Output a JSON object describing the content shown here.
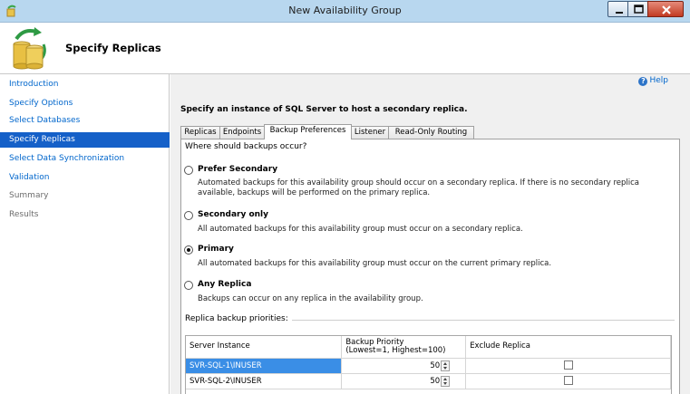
{
  "window": {
    "title": "New Availability Group"
  },
  "header": {
    "page_title": "Specify Replicas"
  },
  "sidebar": {
    "items": [
      {
        "label": "Introduction",
        "state": "link"
      },
      {
        "label": "Specify Options",
        "state": "link"
      },
      {
        "label": "Select Databases",
        "state": "link"
      },
      {
        "label": "Specify Replicas",
        "state": "selected"
      },
      {
        "label": "Select Data Synchronization",
        "state": "link"
      },
      {
        "label": "Validation",
        "state": "link"
      },
      {
        "label": "Summary",
        "state": "inactive"
      },
      {
        "label": "Results",
        "state": "inactive"
      }
    ]
  },
  "main": {
    "help_label": "Help",
    "instruction": "Specify an instance of SQL Server to host a secondary replica.",
    "tabs": [
      {
        "label": "Replicas"
      },
      {
        "label": "Endpoints"
      },
      {
        "label": "Backup Preferences",
        "active": true
      },
      {
        "label": "Listener"
      },
      {
        "label": "Read-Only Routing"
      }
    ],
    "question": "Where should backups occur?",
    "options": [
      {
        "label": "Prefer Secondary",
        "checked": false,
        "description": "Automated backups for this availability group should occur on a secondary replica. If there is no secondary replica available, backups will be performed on the primary replica."
      },
      {
        "label": "Secondary only",
        "checked": false,
        "description": "All automated backups for this availability group must occur on a secondary replica."
      },
      {
        "label": "Primary",
        "checked": true,
        "description": "All automated backups for this availability group must occur on the current primary replica."
      },
      {
        "label": "Any Replica",
        "checked": false,
        "description": "Backups can occur on any replica in the availability group."
      }
    ],
    "priorities_label": "Replica backup priorities:",
    "grid": {
      "headers": [
        "Server Instance",
        "Backup Priority\n(Lowest=1, Highest=100)",
        "Exclude Replica"
      ],
      "rows": [
        {
          "server": "SVR-SQL-1\\INUSER",
          "priority": "50",
          "exclude": false,
          "selected": true
        },
        {
          "server": "SVR-SQL-2\\INUSER",
          "priority": "50",
          "exclude": false,
          "selected": false
        }
      ]
    }
  },
  "colors": {
    "selection": "#1560c8",
    "link": "#0066cc",
    "titlebar": "#b8d7ef"
  }
}
